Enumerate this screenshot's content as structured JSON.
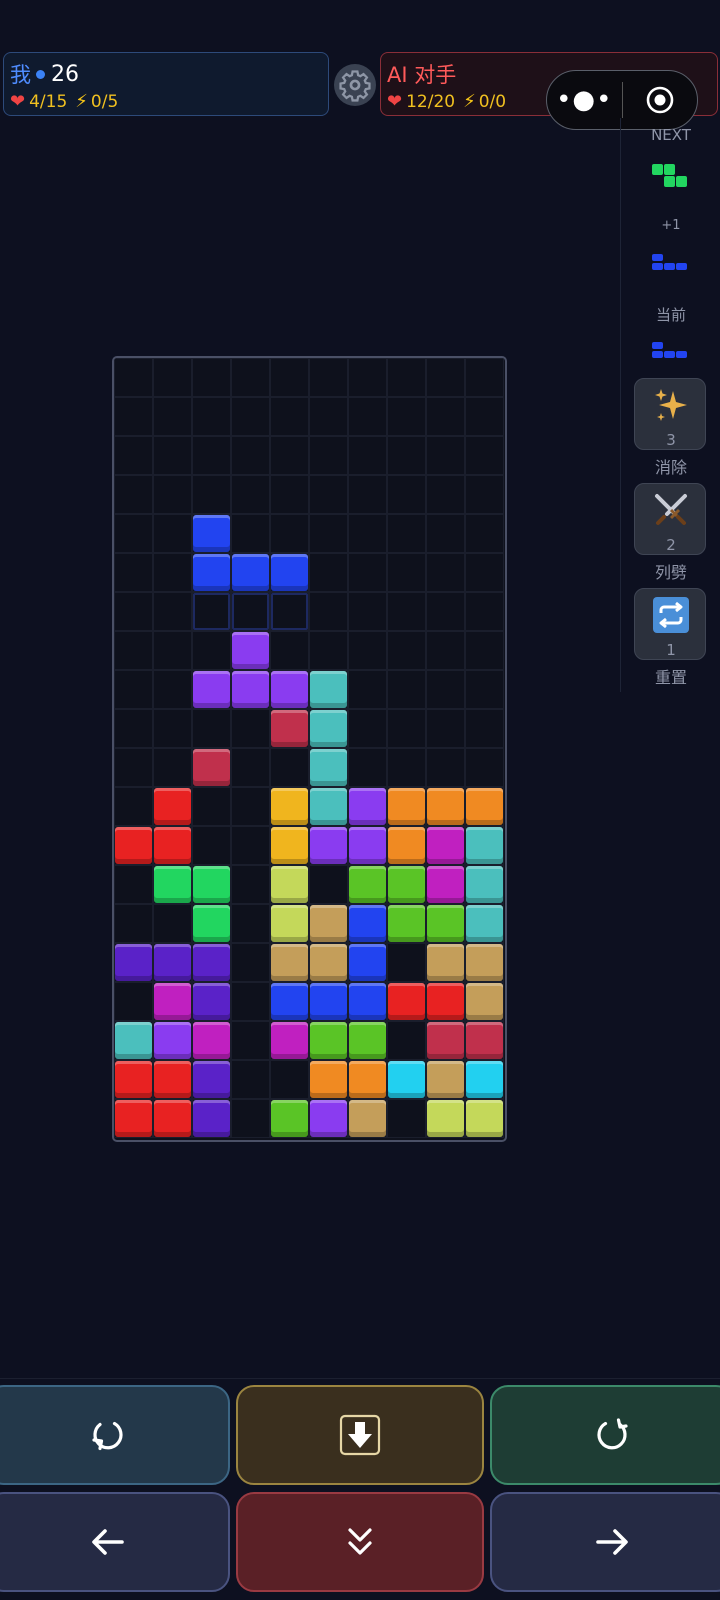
{
  "player": {
    "name": "我",
    "score": "26",
    "hp": "4/15",
    "energy": "0/5"
  },
  "opponent": {
    "name": "AI 对手",
    "hp": "12/20",
    "energy": "0/0"
  },
  "capsule": {
    "more": "•●•"
  },
  "side": {
    "next_label": "NEXT",
    "plus_label": "+1",
    "current_label": "当前",
    "tools": [
      {
        "name": "消除",
        "count": "3",
        "icon": "sparkle-icon"
      },
      {
        "name": "列劈",
        "count": "2",
        "icon": "swords-icon"
      },
      {
        "name": "重置",
        "count": "1",
        "icon": "repeat-icon"
      }
    ]
  },
  "colors": {
    "board_bg": "#0e111c",
    "accent_blue": "#4f8cff",
    "accent_red": "#ff5a5a"
  },
  "board": {
    "cols": 10,
    "rows": 20,
    "active_piece": {
      "color": "#2244f0",
      "cells": [
        [
          2,
          4
        ],
        [
          2,
          5
        ],
        [
          3,
          5
        ],
        [
          4,
          5
        ]
      ]
    },
    "ghost": [
      [
        2,
        6
      ],
      [
        3,
        6
      ],
      [
        4,
        6
      ]
    ],
    "blocks": [
      {
        "c": 3,
        "r": 7,
        "color": "#8a3cf0"
      },
      {
        "c": 2,
        "r": 8,
        "color": "#8a3cf0"
      },
      {
        "c": 3,
        "r": 8,
        "color": "#8a3cf0"
      },
      {
        "c": 4,
        "r": 8,
        "color": "#8a3cf0"
      },
      {
        "c": 5,
        "r": 8,
        "color": "#4bbfbd"
      },
      {
        "c": 4,
        "r": 9,
        "color": "#c0304c"
      },
      {
        "c": 5,
        "r": 9,
        "color": "#4bbfbd"
      },
      {
        "c": 2,
        "r": 10,
        "color": "#c0304c"
      },
      {
        "c": 5,
        "r": 10,
        "color": "#4bbfbd"
      },
      {
        "c": 1,
        "r": 11,
        "color": "#e82222"
      },
      {
        "c": 4,
        "r": 11,
        "color": "#f0b51e"
      },
      {
        "c": 5,
        "r": 11,
        "color": "#4bbfbd"
      },
      {
        "c": 6,
        "r": 11,
        "color": "#8a3cf0"
      },
      {
        "c": 7,
        "r": 11,
        "color": "#f08a22"
      },
      {
        "c": 8,
        "r": 11,
        "color": "#f08a22"
      },
      {
        "c": 9,
        "r": 11,
        "color": "#f08a22"
      },
      {
        "c": 0,
        "r": 12,
        "color": "#e82222"
      },
      {
        "c": 1,
        "r": 12,
        "color": "#e82222"
      },
      {
        "c": 4,
        "r": 12,
        "color": "#f0b51e"
      },
      {
        "c": 5,
        "r": 12,
        "color": "#8a3cf0"
      },
      {
        "c": 6,
        "r": 12,
        "color": "#8a3cf0"
      },
      {
        "c": 7,
        "r": 12,
        "color": "#f08a22"
      },
      {
        "c": 8,
        "r": 12,
        "color": "#c020c0"
      },
      {
        "c": 9,
        "r": 12,
        "color": "#4bbfbd"
      },
      {
        "c": 1,
        "r": 13,
        "color": "#22d660"
      },
      {
        "c": 2,
        "r": 13,
        "color": "#22d660"
      },
      {
        "c": 4,
        "r": 13,
        "color": "#c4d85a"
      },
      {
        "c": 6,
        "r": 13,
        "color": "#5ac426"
      },
      {
        "c": 7,
        "r": 13,
        "color": "#5ac426"
      },
      {
        "c": 8,
        "r": 13,
        "color": "#c020c0"
      },
      {
        "c": 9,
        "r": 13,
        "color": "#4bbfbd"
      },
      {
        "c": 2,
        "r": 14,
        "color": "#22d660"
      },
      {
        "c": 4,
        "r": 14,
        "color": "#c4d85a"
      },
      {
        "c": 5,
        "r": 14,
        "color": "#c49e5a"
      },
      {
        "c": 6,
        "r": 14,
        "color": "#2244f0"
      },
      {
        "c": 7,
        "r": 14,
        "color": "#5ac426"
      },
      {
        "c": 8,
        "r": 14,
        "color": "#5ac426"
      },
      {
        "c": 9,
        "r": 14,
        "color": "#4bbfbd"
      },
      {
        "c": 0,
        "r": 15,
        "color": "#5a22c8"
      },
      {
        "c": 1,
        "r": 15,
        "color": "#5a22c8"
      },
      {
        "c": 2,
        "r": 15,
        "color": "#5a22c8"
      },
      {
        "c": 4,
        "r": 15,
        "color": "#c49e5a"
      },
      {
        "c": 5,
        "r": 15,
        "color": "#c49e5a"
      },
      {
        "c": 6,
        "r": 15,
        "color": "#2244f0"
      },
      {
        "c": 8,
        "r": 15,
        "color": "#c49e5a"
      },
      {
        "c": 9,
        "r": 15,
        "color": "#c49e5a"
      },
      {
        "c": 1,
        "r": 16,
        "color": "#c020c0"
      },
      {
        "c": 2,
        "r": 16,
        "color": "#5a22c8"
      },
      {
        "c": 4,
        "r": 16,
        "color": "#2244f0"
      },
      {
        "c": 5,
        "r": 16,
        "color": "#2244f0"
      },
      {
        "c": 6,
        "r": 16,
        "color": "#2244f0"
      },
      {
        "c": 7,
        "r": 16,
        "color": "#e82222"
      },
      {
        "c": 8,
        "r": 16,
        "color": "#e82222"
      },
      {
        "c": 9,
        "r": 16,
        "color": "#c49e5a"
      },
      {
        "c": 0,
        "r": 17,
        "color": "#4bbfbd"
      },
      {
        "c": 1,
        "r": 17,
        "color": "#8a3cf0"
      },
      {
        "c": 2,
        "r": 17,
        "color": "#c020c0"
      },
      {
        "c": 4,
        "r": 17,
        "color": "#c020c0"
      },
      {
        "c": 5,
        "r": 17,
        "color": "#5ac426"
      },
      {
        "c": 6,
        "r": 17,
        "color": "#5ac426"
      },
      {
        "c": 8,
        "r": 17,
        "color": "#c0304c"
      },
      {
        "c": 9,
        "r": 17,
        "color": "#c0304c"
      },
      {
        "c": 0,
        "r": 18,
        "color": "#e82222"
      },
      {
        "c": 1,
        "r": 18,
        "color": "#e82222"
      },
      {
        "c": 2,
        "r": 18,
        "color": "#5a22c8"
      },
      {
        "c": 5,
        "r": 18,
        "color": "#f08a22"
      },
      {
        "c": 6,
        "r": 18,
        "color": "#f08a22"
      },
      {
        "c": 7,
        "r": 18,
        "color": "#22d0f0"
      },
      {
        "c": 8,
        "r": 18,
        "color": "#c49e5a"
      },
      {
        "c": 9,
        "r": 18,
        "color": "#22d0f0"
      },
      {
        "c": 0,
        "r": 19,
        "color": "#e82222"
      },
      {
        "c": 1,
        "r": 19,
        "color": "#e82222"
      },
      {
        "c": 2,
        "r": 19,
        "color": "#5a22c8"
      },
      {
        "c": 4,
        "r": 19,
        "color": "#5ac426"
      },
      {
        "c": 5,
        "r": 19,
        "color": "#8a3cf0"
      },
      {
        "c": 6,
        "r": 19,
        "color": "#c49e5a"
      },
      {
        "c": 8,
        "r": 19,
        "color": "#c4d85a"
      },
      {
        "c": 9,
        "r": 19,
        "color": "#c4d85a"
      }
    ]
  },
  "controls": [
    {
      "name": "rotate-ccw-button",
      "icon": "rotate-ccw-icon"
    },
    {
      "name": "hard-drop-button",
      "icon": "hard-drop-icon"
    },
    {
      "name": "rotate-cw-button",
      "icon": "rotate-cw-icon"
    },
    {
      "name": "move-left-button",
      "icon": "arrow-left-icon"
    },
    {
      "name": "soft-drop-button",
      "icon": "double-chevron-down-icon"
    },
    {
      "name": "move-right-button",
      "icon": "arrow-right-icon"
    }
  ]
}
